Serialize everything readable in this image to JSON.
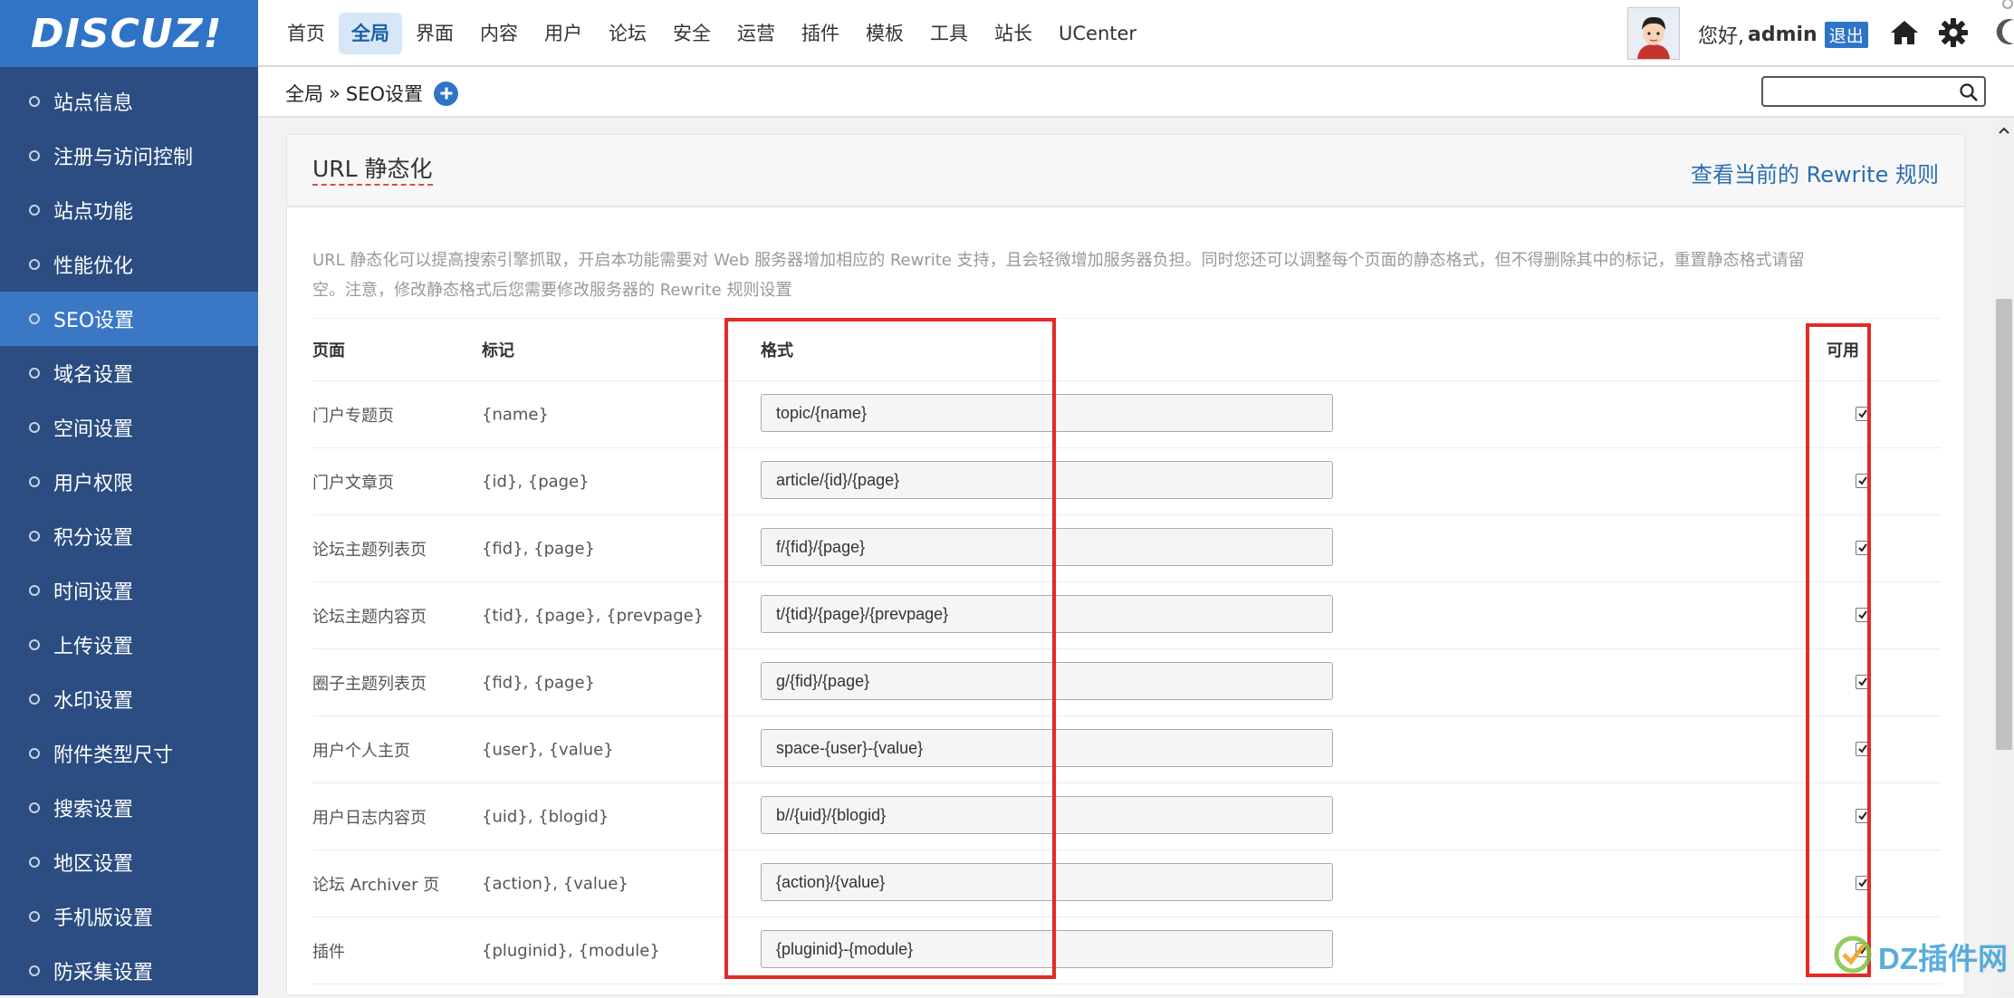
{
  "sidebar": {
    "logo": "DISCUZ!",
    "items": [
      {
        "label": "站点信息"
      },
      {
        "label": "注册与访问控制"
      },
      {
        "label": "站点功能"
      },
      {
        "label": "性能优化"
      },
      {
        "label": "SEO设置",
        "active": true
      },
      {
        "label": "域名设置"
      },
      {
        "label": "空间设置"
      },
      {
        "label": "用户权限"
      },
      {
        "label": "积分设置"
      },
      {
        "label": "时间设置"
      },
      {
        "label": "上传设置"
      },
      {
        "label": "水印设置"
      },
      {
        "label": "附件类型尺寸"
      },
      {
        "label": "搜索设置"
      },
      {
        "label": "地区设置"
      },
      {
        "label": "手机版设置"
      },
      {
        "label": "防采集设置"
      }
    ]
  },
  "topnav": {
    "items": [
      {
        "label": "首页"
      },
      {
        "label": "全局",
        "active": true
      },
      {
        "label": "界面"
      },
      {
        "label": "内容"
      },
      {
        "label": "用户"
      },
      {
        "label": "论坛"
      },
      {
        "label": "安全"
      },
      {
        "label": "运营"
      },
      {
        "label": "插件"
      },
      {
        "label": "模板"
      },
      {
        "label": "工具"
      },
      {
        "label": "站长"
      },
      {
        "label": "UCenter"
      }
    ],
    "greeting": "您好,",
    "username": "admin",
    "logout": "退出",
    "icons": [
      "home-icon",
      "gear-icon"
    ]
  },
  "subbar": {
    "crumb_root": "全局",
    "crumb_sep": "»",
    "crumb_current": "SEO设置",
    "search_value": ""
  },
  "panel": {
    "title": "URL 静态化",
    "link": "查看当前的 Rewrite 规则",
    "desc": "URL 静态化可以提高搜索引擎抓取，开启本功能需要对 Web 服务器增加相应的 Rewrite 支持，且会轻微增加服务器负担。同时您还可以调整每个页面的静态格式，但不得删除其中的标记，重置静态格式请留空。注意，修改静态格式后您需要修改服务器的 Rewrite 规则设置"
  },
  "table": {
    "headers": {
      "page": "页面",
      "mark": "标记",
      "format": "格式",
      "enable": "可用"
    },
    "rows": [
      {
        "page": "门户专题页",
        "mark": "{name}",
        "format": "topic/{name}",
        "enabled": true
      },
      {
        "page": "门户文章页",
        "mark": "{id}, {page}",
        "format": "article/{id}/{page}",
        "enabled": true
      },
      {
        "page": "论坛主题列表页",
        "mark": "{fid}, {page}",
        "format": "f/{fid}/{page}",
        "enabled": true
      },
      {
        "page": "论坛主题内容页",
        "mark": "{tid}, {page}, {prevpage}",
        "format": "t/{tid}/{page}/{prevpage}",
        "enabled": true
      },
      {
        "page": "圈子主题列表页",
        "mark": "{fid}, {page}",
        "format": "g/{fid}/{page}",
        "enabled": true
      },
      {
        "page": "用户个人主页",
        "mark": "{user}, {value}",
        "format": "space-{user}-{value}",
        "enabled": true
      },
      {
        "page": "用户日志内容页",
        "mark": "{uid}, {blogid}",
        "format": "b//{uid}/{blogid}",
        "enabled": true
      },
      {
        "page": "论坛 Archiver 页",
        "mark": "{action}, {value}",
        "format": "{action}/{value}",
        "enabled": true
      },
      {
        "page": "插件",
        "mark": "{pluginid}, {module}",
        "format": "{pluginid}-{module}",
        "enabled": true
      }
    ]
  },
  "watermark": {
    "text": "DZ插件网"
  },
  "colors": {
    "sidebar": "#2b4d82",
    "accent": "#2f74c6",
    "highlight": "#e02b27"
  }
}
